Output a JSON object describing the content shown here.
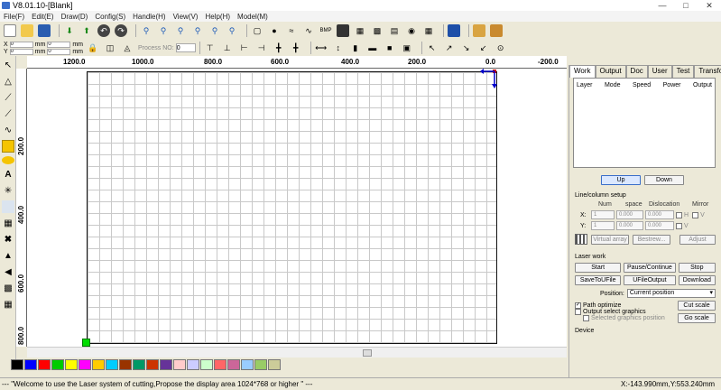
{
  "window": {
    "title": "V8.01.10-[Blank]"
  },
  "menu": [
    "File(F)",
    "Edit(E)",
    "Draw(D)",
    "Config(S)",
    "Handle(H)",
    "View(V)",
    "Help(H)",
    "Model(M)"
  ],
  "coords": {
    "x_label": "X",
    "y_label": "Y",
    "x_value": "0",
    "y_value": "0",
    "unit": "mm",
    "w_value": "0",
    "h_value": "0"
  },
  "process_no": {
    "label": "Process NO:",
    "value": "0"
  },
  "ruler": {
    "h_labels": [
      "1200.0",
      "1000.0",
      "800.0",
      "600.0",
      "400.0",
      "200.0",
      "0.0",
      "-200.0"
    ],
    "v_labels": [
      "200.0",
      "400.0",
      "600.0",
      "800.0"
    ]
  },
  "right_panel": {
    "tabs": [
      "Work",
      "Output",
      "Doc",
      "User",
      "Test",
      "Transform"
    ],
    "layer_columns": [
      "Layer",
      "Mode",
      "Speed",
      "Power",
      "Output"
    ],
    "up_label": "Up",
    "down_label": "Down",
    "line_column": {
      "title": "Line/column setup",
      "headers": [
        "Num",
        "space",
        "Dislocation",
        "Mirror"
      ],
      "rows": [
        {
          "axis": "X:",
          "num": "1",
          "space": "0.000",
          "dislocation": "0.000",
          "mirror": "H"
        },
        {
          "axis": "Y:",
          "num": "1",
          "space": "0.000",
          "dislocation": "0.000",
          "mirror": "V"
        }
      ],
      "virtual_array": "Virtual array",
      "bestrew": "Bestrew...",
      "adjust": "Adjust"
    },
    "laser_work": {
      "title": "Laser work",
      "start": "Start",
      "pause": "Pause/Continue",
      "stop": "Stop",
      "save_ufile": "SaveToUFile",
      "ufile_output": "UFileOutput",
      "download": "Download",
      "position_label": "Position:",
      "position_value": "Current position",
      "path_optimize": "Path optimize",
      "output_select": "Output select graphics",
      "selected_position": "Selected graphics position",
      "cut_scale": "Cut scale",
      "go_scale": "Go scale"
    },
    "device_label": "Device"
  },
  "palette": [
    "#000000",
    "#0000ff",
    "#ff0000",
    "#00cc00",
    "#ffff00",
    "#ff00ff",
    "#ffcc00",
    "#00ccff",
    "#993300",
    "#009966",
    "#cc3300",
    "#663399",
    "#ffcccc",
    "#ccccff",
    "#ccffcc",
    "#ff6666",
    "#cc6699",
    "#99ccff",
    "#99cc66",
    "#cccc99"
  ],
  "status": {
    "message": "--- \"Welcome to use the Laser system of cutting,Propose the display area 1024*768 or higher \" ---",
    "position": "X:-143.990mm,Y:553.240mm"
  },
  "colors": {
    "origin_marker": "#00dd00",
    "head_marker": "#cc0000",
    "arrow": "#0000cc"
  }
}
